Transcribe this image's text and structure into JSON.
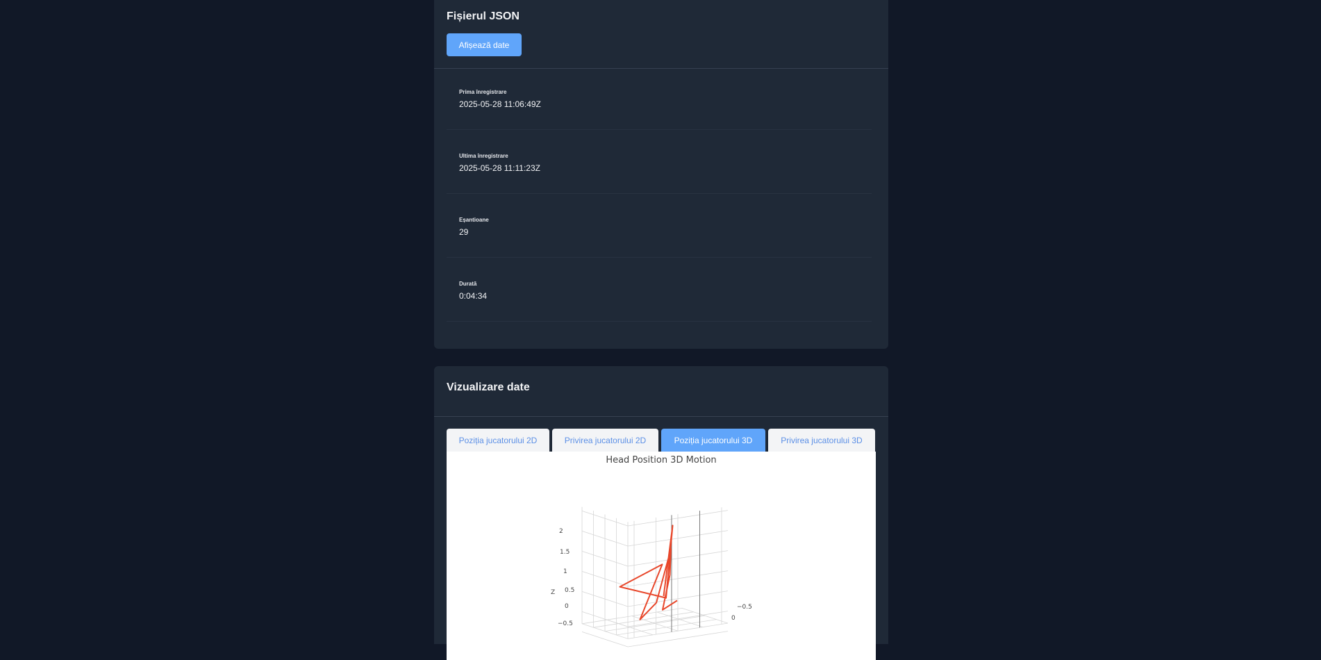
{
  "json_panel": {
    "title": "Fișierul JSON",
    "show_button": "Afișează date",
    "stats": [
      {
        "label": "Prima înregistrare",
        "value": "2025-05-28 11:06:49Z"
      },
      {
        "label": "Ultima înregistrare",
        "value": "2025-05-28 11:11:23Z"
      },
      {
        "label": "Eșantioane",
        "value": "29"
      },
      {
        "label": "Durată",
        "value": "0:04:34"
      }
    ]
  },
  "viz_panel": {
    "title": "Vizualizare date",
    "tabs": [
      {
        "label": "Poziția jucatorului 2D",
        "active": false
      },
      {
        "label": "Privirea jucatorului 2D",
        "active": false
      },
      {
        "label": "Poziția jucatorului 3D",
        "active": true
      },
      {
        "label": "Privirea jucatorului 3D",
        "active": false
      }
    ],
    "accent_color": "#60a5fa"
  },
  "chart_data": {
    "type": "line",
    "title": "Head Position 3D Motion",
    "zlabel": "Z",
    "z_ticks": [
      "2",
      "1.5",
      "1",
      "0.5",
      "0",
      "−0.5"
    ],
    "y_ticks": [
      "−0.5",
      "0"
    ],
    "series": [
      {
        "color": "#e8472b",
        "points": [
          {
            "x": 0.2,
            "y": -0.1,
            "z": 0.3
          },
          {
            "x": 0.1,
            "y": 0.3,
            "z": 2.2
          },
          {
            "x": 0.3,
            "y": -0.2,
            "z": 0.2
          },
          {
            "x": -0.5,
            "y": -0.1,
            "z": 0.7
          },
          {
            "x": 0.3,
            "y": -0.3,
            "z": 1.0
          },
          {
            "x": -0.3,
            "y": 0.1,
            "z": -0.1
          },
          {
            "x": -0.1,
            "y": 0.2,
            "z": 0.3
          },
          {
            "x": 0.5,
            "y": -0.4,
            "z": 1.3
          },
          {
            "x": 0.3,
            "y": -0.1,
            "z": 0.8
          },
          {
            "x": 0.0,
            "y": 0.2,
            "z": 0.1
          },
          {
            "x": 0.6,
            "y": -0.4,
            "z": 0.0
          }
        ]
      }
    ]
  }
}
